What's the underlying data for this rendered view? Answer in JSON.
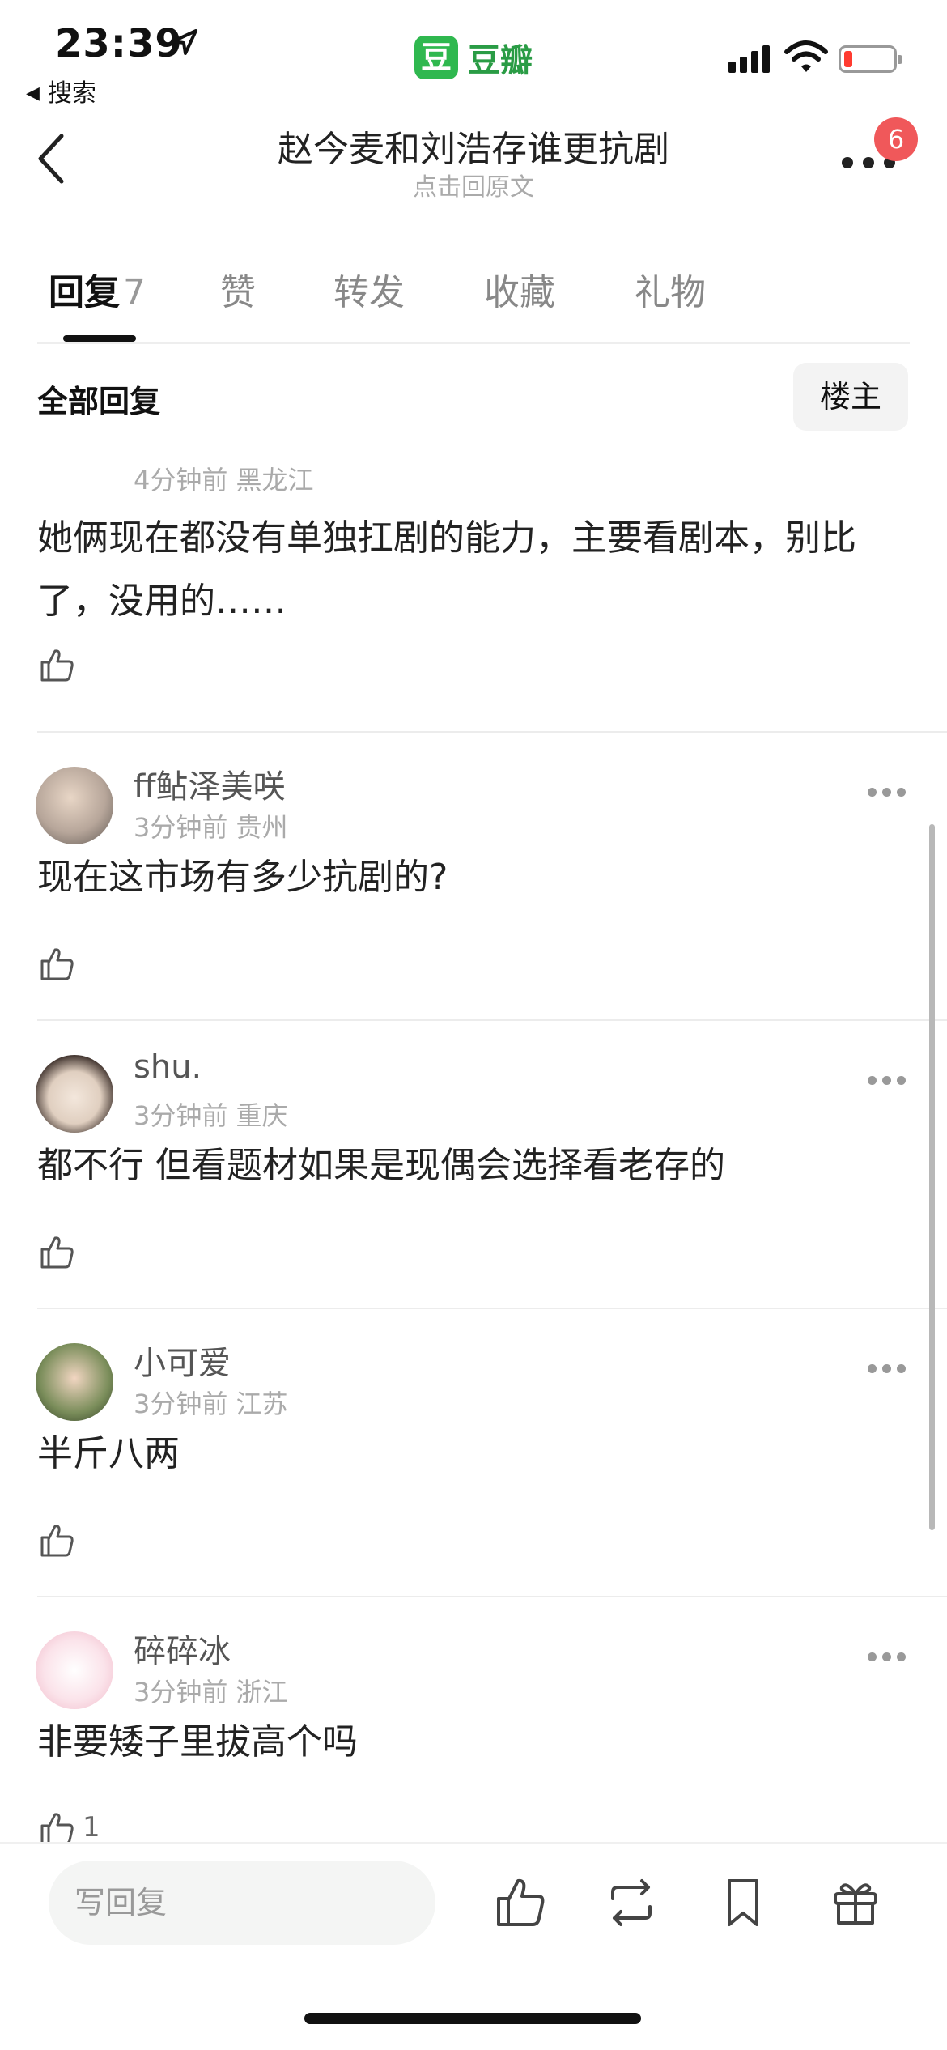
{
  "status_bar": {
    "time": "23:39",
    "back_app_label": "搜索",
    "app_logo_char": "豆",
    "app_name": "豆瓣",
    "battery_color": "#ff3b30"
  },
  "nav": {
    "title": "赵今麦和刘浩存谁更抗剧",
    "subtitle": "点击回原文",
    "notification_count": "6",
    "back_icon": "chevron-left-icon",
    "more_icon": "more-horizontal-icon"
  },
  "tabs": [
    {
      "label": "回复",
      "count": "7",
      "active": true
    },
    {
      "label": "赞",
      "count": "",
      "active": false
    },
    {
      "label": "转发",
      "count": "",
      "active": false
    },
    {
      "label": "收藏",
      "count": "",
      "active": false
    },
    {
      "label": "礼物",
      "count": "",
      "active": false
    }
  ],
  "section": {
    "title": "全部回复",
    "op_filter_label": "楼主"
  },
  "comments": [
    {
      "username": "",
      "time": "4分钟前",
      "location": "黑龙江",
      "meta": "4分钟前 黑龙江",
      "text": "她俩现在都没有单独扛剧的能力，主要看剧本，别比了，没用的……",
      "likes": ""
    },
    {
      "username": "ff鲇泽美咲",
      "time": "3分钟前",
      "location": "贵州",
      "meta": "3分钟前 贵州",
      "text": "现在这市场有多少抗剧的?",
      "likes": ""
    },
    {
      "username": "shu.",
      "time": "3分钟前",
      "location": "重庆",
      "meta": "3分钟前 重庆",
      "text": "都不行 但看题材如果是现偶会选择看老存的",
      "likes": ""
    },
    {
      "username": "小可爱",
      "time": "3分钟前",
      "location": "江苏",
      "meta": "3分钟前 江苏",
      "text": "半斤八两",
      "likes": ""
    },
    {
      "username": "碎碎冰",
      "time": "3分钟前",
      "location": "浙江",
      "meta": "3分钟前 浙江",
      "text": "非要矮子里拔高个吗",
      "likes": "1"
    }
  ],
  "bottom_bar": {
    "reply_placeholder": "写回复",
    "icons": [
      "thumbs-up-icon",
      "repost-icon",
      "bookmark-icon",
      "gift-icon"
    ]
  },
  "colors": {
    "brand_green": "#2fb84f",
    "badge_red": "#f0585a"
  }
}
